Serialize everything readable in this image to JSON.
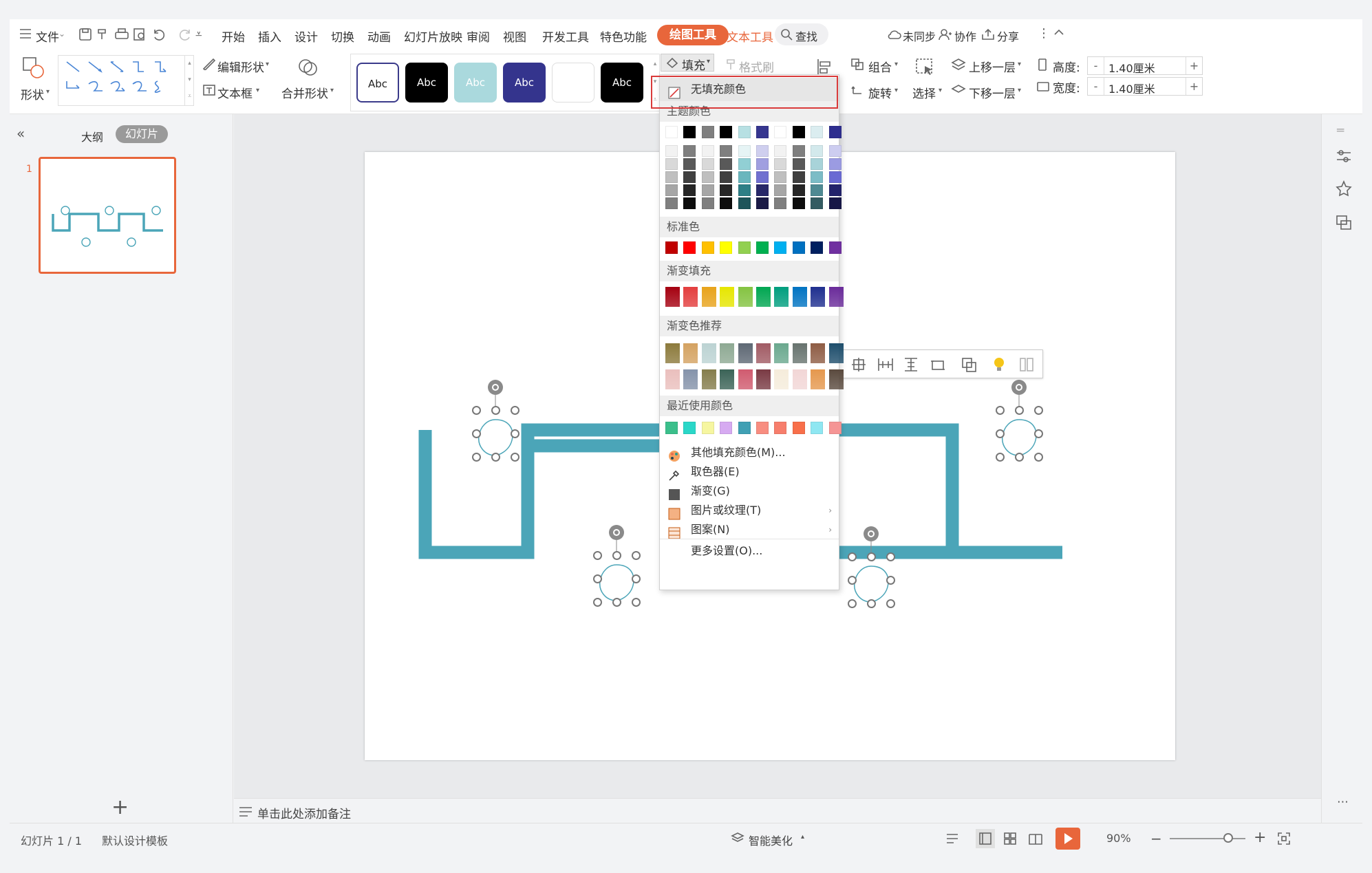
{
  "menubar": {
    "file": "文件",
    "tabs": [
      "开始",
      "插入",
      "设计",
      "切换",
      "动画",
      "幻灯片放映",
      "审阅",
      "视图",
      "开发工具",
      "特色功能"
    ],
    "drawing_tools": "绘图工具",
    "text_tools": "文本工具",
    "search": "查找",
    "sync": "未同步",
    "collab": "协作",
    "share": "分享"
  },
  "ribbon": {
    "shape": "形状",
    "edit_shape": "编辑形状",
    "text_box": "文本框",
    "merge_shape": "合并形状",
    "style_boxes": [
      "Abc",
      "Abc",
      "Abc",
      "Abc",
      "",
      "Abc"
    ],
    "fill": "填充",
    "format_brush": "格式刷",
    "group": "组合",
    "rotate": "旋转",
    "select": "选择",
    "bring_forward": "上移一层",
    "send_backward": "下移一层",
    "height_label": "高度:",
    "height_value": "1.40厘米",
    "width_label": "宽度:",
    "width_value": "1.40厘米",
    "minus": "-",
    "plus": "+"
  },
  "leftpanel": {
    "outline_tab": "大纲",
    "slides_tab": "幻灯片",
    "slide_number": "1",
    "add": "+"
  },
  "fill_menu": {
    "no_fill": "无填充颜色",
    "theme_colors": "主题颜色",
    "standard_colors": "标准色",
    "gradient_fill": "渐变填充",
    "gradient_recommend": "渐变色推荐",
    "recent_colors": "最近使用颜色",
    "items": [
      {
        "label": "其他填充颜色(M)...",
        "icon": "palette-icon",
        "arrow": ""
      },
      {
        "label": "取色器(E)",
        "icon": "eyedropper-icon",
        "arrow": ""
      },
      {
        "label": "渐变(G)",
        "icon": "gradient-icon",
        "arrow": ""
      },
      {
        "label": "图片或纹理(T)",
        "icon": "texture-icon",
        "arrow": "›"
      },
      {
        "label": "图案(N)",
        "icon": "pattern-icon",
        "arrow": "›"
      },
      {
        "label": "更多设置(O)...",
        "icon": "",
        "arrow": ""
      }
    ],
    "theme_top": [
      "#ffffff",
      "#000000",
      "#7f7f7f",
      "#000000",
      "#b7e0e3",
      "#36368f",
      "#ffffff",
      "#000000",
      "#dbedf0",
      "#2e2e8f"
    ],
    "theme_shades": [
      [
        "#f2f2f2",
        "#7f7f7f",
        "#f2f2f2",
        "#7f7f7f",
        "#e6f4f5",
        "#cfcfef",
        "#f2f2f2",
        "#7f7f7f",
        "#d3e9ec",
        "#cdcdf0"
      ],
      [
        "#d9d9d9",
        "#595959",
        "#d9d9d9",
        "#595959",
        "#91cfd4",
        "#a09fe0",
        "#d9d9d9",
        "#595959",
        "#a8d3d9",
        "#9b9be2"
      ],
      [
        "#bfbfbf",
        "#404040",
        "#bfbfbf",
        "#404040",
        "#6ab6bd",
        "#7070d0",
        "#bfbfbf",
        "#404040",
        "#7cbcc6",
        "#6a6ad3"
      ],
      [
        "#a6a6a6",
        "#262626",
        "#a6a6a6",
        "#262626",
        "#2e7f86",
        "#272769",
        "#a6a6a6",
        "#262626",
        "#4f8a93",
        "#22226b"
      ],
      [
        "#7f7f7f",
        "#0d0d0d",
        "#7f7f7f",
        "#0d0d0d",
        "#1e555a",
        "#1a1a46",
        "#7f7f7f",
        "#0d0d0d",
        "#345c62",
        "#171747"
      ]
    ],
    "standard": [
      "#c00000",
      "#ff0000",
      "#ffc000",
      "#ffff00",
      "#92d050",
      "#00b050",
      "#00b0f0",
      "#0070c0",
      "#002060",
      "#7030a0"
    ],
    "gradient": [
      "#a50010",
      "#e33e3e",
      "#e8a31b",
      "#e6e600",
      "#84c341",
      "#00a651",
      "#009e7e",
      "#0073c2",
      "#1f2f8f",
      "#6a2b9a"
    ],
    "recommend_row1": [
      "#8c7a3c",
      "#d4a261",
      "#bcd3d3",
      "#8ea993",
      "#5e6874",
      "#a15b64",
      "#6aa88e",
      "#67736e",
      "#8e5c44",
      "#1e4e6c"
    ],
    "recommend_row2": [
      "#eabfbd",
      "#8593aa",
      "#857d4c",
      "#3b6357",
      "#d05b6f",
      "#7a3a44",
      "#f5ecdb",
      "#f2d6d6",
      "#e5984e",
      "#5a4a3e"
    ],
    "recent": [
      "#3bbf8b",
      "#2ad7c8",
      "#f6f6a0",
      "#d6aaf1",
      "#40a0b4",
      "#f88d80",
      "#f77e6c",
      "#f86f4a",
      "#8fe7f2",
      "#f59595"
    ]
  },
  "notes": {
    "placeholder": "单击此处添加备注"
  },
  "status": {
    "slide_info": "幻灯片 1 / 1",
    "template": "默认设计模板",
    "smart_beautify": "智能美化",
    "zoom": "90%"
  },
  "colors": {
    "accent": "#e8663b",
    "shape_line": "#4ba5b8",
    "highlight_box": "#d93a3a"
  }
}
